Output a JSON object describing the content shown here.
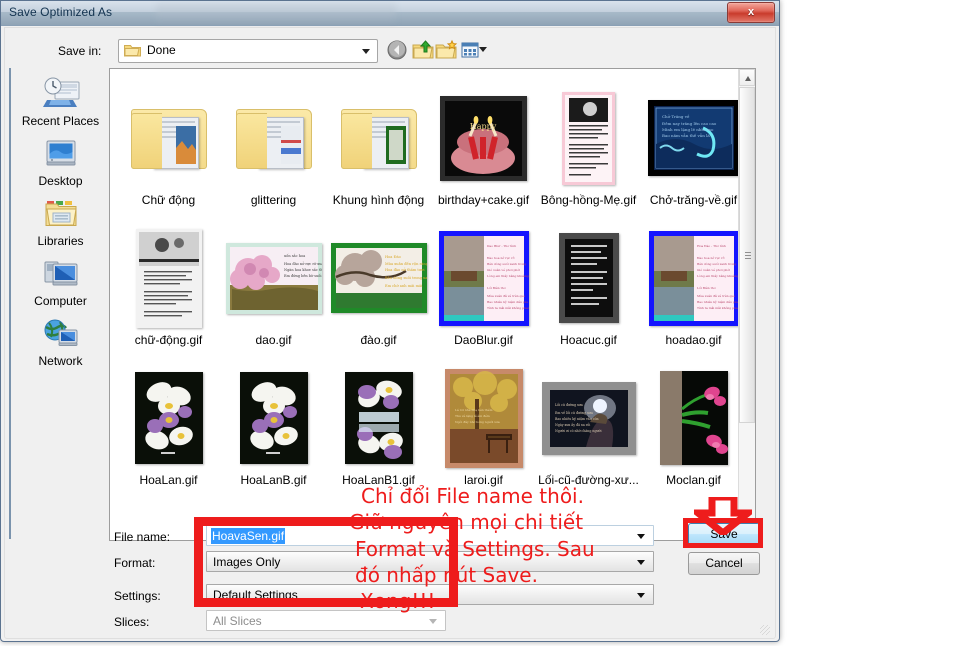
{
  "window": {
    "title": "Save Optimized As",
    "close_label": "x"
  },
  "toolbar": {
    "save_in_label": "Save in:",
    "current_folder": "Done",
    "icons": [
      "back-icon",
      "up-one-level-icon",
      "new-folder-icon",
      "views-icon"
    ]
  },
  "places": {
    "items": [
      {
        "label": "Recent Places",
        "icon": "recent-places-icon"
      },
      {
        "label": "Desktop",
        "icon": "desktop-icon"
      },
      {
        "label": "Libraries",
        "icon": "libraries-icon"
      },
      {
        "label": "Computer",
        "icon": "computer-icon"
      },
      {
        "label": "Network",
        "icon": "network-icon"
      }
    ]
  },
  "file_list": {
    "items": [
      {
        "name": "Chữ động",
        "kind": "folder"
      },
      {
        "name": "glittering",
        "kind": "folder"
      },
      {
        "name": "Khung hình động",
        "kind": "folder"
      },
      {
        "name": "birthday+cake.gif",
        "kind": "image",
        "style": "birthday"
      },
      {
        "name": "Bông-hồng-Mẹ.gif",
        "kind": "image",
        "style": "pinkpoem"
      },
      {
        "name": "Chở-trăng-về.gif",
        "kind": "image",
        "style": "bluenight"
      },
      {
        "name": "chữ-động.gif",
        "kind": "image",
        "style": "bwpoem"
      },
      {
        "name": "dao.gif",
        "kind": "image",
        "style": "blossompastel"
      },
      {
        "name": "đào.gif",
        "kind": "image",
        "style": "greenframe"
      },
      {
        "name": "DaoBlur.gif",
        "kind": "image",
        "style": "blueframe"
      },
      {
        "name": "Hoacuc.gif",
        "kind": "image",
        "style": "darkgrain"
      },
      {
        "name": "hoadao.gif",
        "kind": "image",
        "style": "blueframe"
      },
      {
        "name": "HoaLan.gif",
        "kind": "image",
        "style": "orchid"
      },
      {
        "name": "HoaLanB.gif",
        "kind": "image",
        "style": "orchid"
      },
      {
        "name": "HoaLanB1.gif",
        "kind": "image",
        "style": "orchid2"
      },
      {
        "name": "laroi.gif",
        "kind": "image",
        "style": "autumn"
      },
      {
        "name": "Lối-cũ-đường-xư...",
        "kind": "image",
        "style": "nightgrey"
      },
      {
        "name": "Moclan.gif",
        "kind": "image",
        "style": "pinkflower"
      }
    ]
  },
  "form": {
    "file_name_label": "File name:",
    "file_name_value": "HoavaSen.gif",
    "format_label": "Format:",
    "format_value": "Images Only",
    "settings_label": "Settings:",
    "settings_value": "Default Settings",
    "slices_label": "Slices:",
    "slices_value": "All Slices"
  },
  "buttons": {
    "save": "Save",
    "cancel": "Cancel"
  },
  "annotations": {
    "color": "#ee1c1c",
    "line1": "Chỉ đổi File name thôi.",
    "line2": "Giữ nguyên mọi chi tiết",
    "line3": "Format và Settings.  Sau",
    "line4": "đó nhấp nút Save.",
    "line5": "Xong!!!"
  }
}
